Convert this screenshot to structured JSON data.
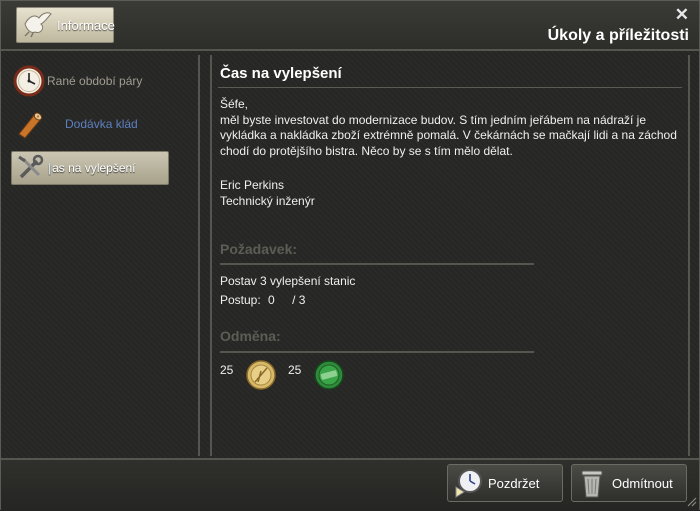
{
  "header": {
    "info_label": "Informace",
    "title": "Úkoly a příležitosti",
    "close_glyph": "✕"
  },
  "quests": [
    {
      "label": "Rané období páry",
      "icon": "clock-icon"
    },
    {
      "label": "Dodávka klád",
      "icon": "log-icon"
    },
    {
      "label": "as na vylepšení",
      "icon": "wrench-icon",
      "active": true
    }
  ],
  "detail": {
    "heading": "Čas na vylepšení",
    "greeting": "Šéfe,",
    "body": "měl byste investovat do modernizace budov. S tím jedním jeřábem na nádraží je vykládka a nakládka zboží extrémně pomalá. V čekárnách se mačkají lidi a na záchod chodí do protějšího bistra. Něco by se s tím mělo dělat.",
    "signature_name": "Eric Perkins",
    "signature_role": "Technický inženýr"
  },
  "requirement": {
    "title": "Požadavek:",
    "build_line": "Postav 3   vylepšení stanic",
    "progress_label": "Postup:",
    "progress_current": "0",
    "progress_total": "/ 3"
  },
  "reward": {
    "title": "Odměna:",
    "items": [
      {
        "value": "25",
        "icon": "prestige-medal-icon"
      },
      {
        "value": "25",
        "icon": "money-coin-icon"
      }
    ]
  },
  "footer": {
    "postpone_label": "Pozdržet",
    "reject_label": "Odmítnout"
  },
  "colors": {
    "accent_text": "#ffffff",
    "section_title": "#5c5d56",
    "quest_link": "#5d7fc0"
  }
}
